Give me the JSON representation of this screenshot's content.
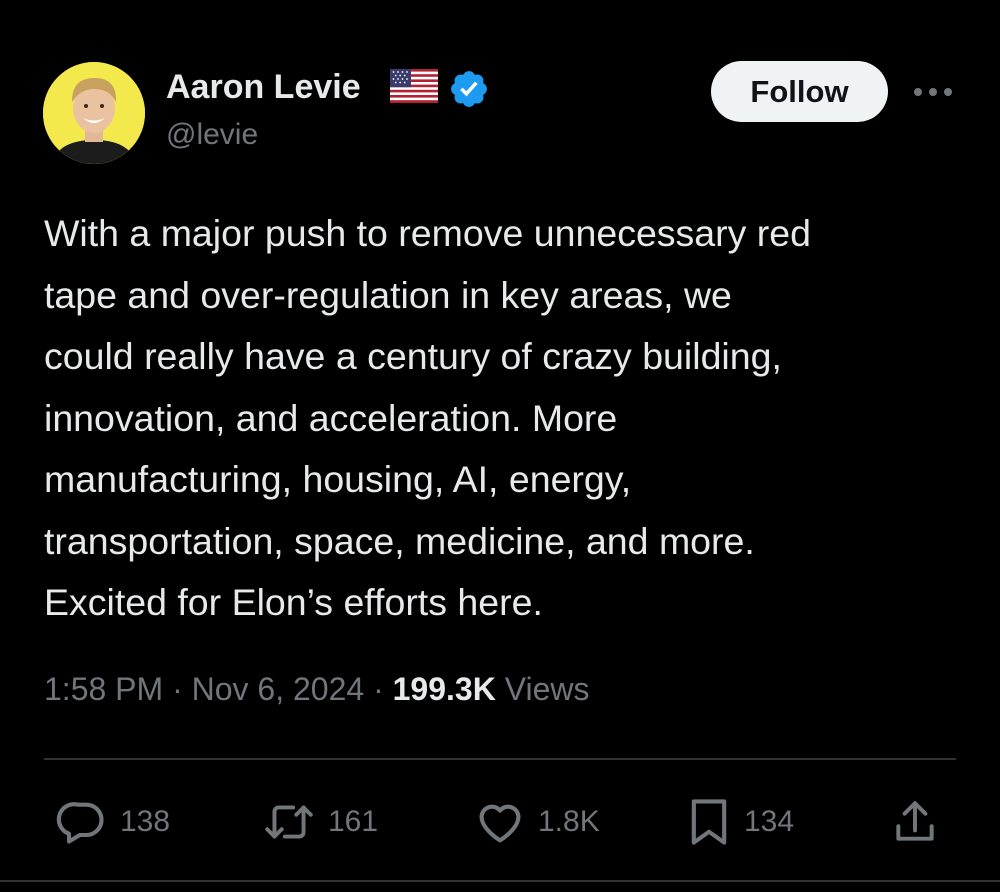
{
  "author": {
    "name": "Aaron Levie",
    "handle": "@levie",
    "flag_icon": "us-flag-icon",
    "verified_icon": "verified-badge-icon",
    "verified_color": "#1d9bf0",
    "avatar_bg": "#f3e84c"
  },
  "header": {
    "follow_label": "Follow",
    "more_icon": "more-icon"
  },
  "tweet": {
    "text": "With a major push to remove unnecessary red\ntape and over-regulation in key areas, we\ncould really have a century of crazy building,\ninnovation, and acceleration. More\nmanufacturing, housing, AI, energy,\ntransportation, space, medicine, and more.\nExcited for Elon’s efforts here."
  },
  "meta": {
    "time": "1:58 PM",
    "date": "Nov 6, 2024",
    "separator": "·",
    "views_count": "199.3K",
    "views_label": "Views"
  },
  "actions": {
    "replies": "138",
    "reposts": "161",
    "likes": "1.8K",
    "bookmarks": "134"
  },
  "colors": {
    "background": "#000000",
    "primary_text": "#e7e9ea",
    "secondary_text": "#71767b",
    "divider": "#2f3336"
  }
}
